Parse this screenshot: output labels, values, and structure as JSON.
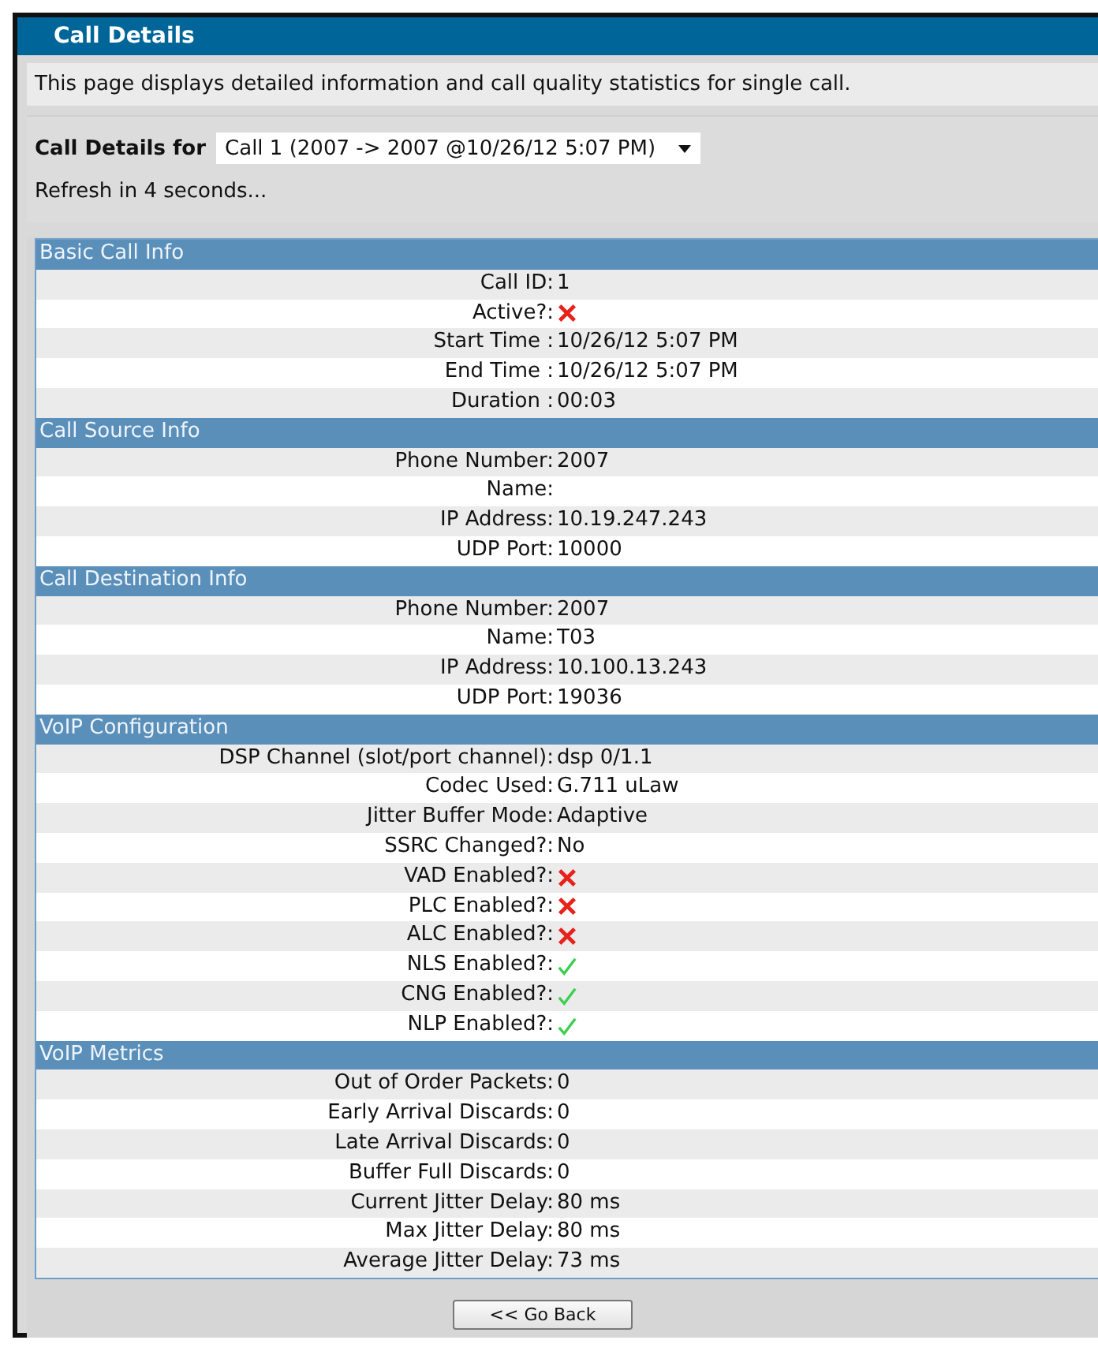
{
  "window": {
    "title": "Call Details"
  },
  "description": "This page displays detailed information and call quality statistics for single call.",
  "selector": {
    "label": "Call Details for",
    "value": "Call 1 (2007 -> 2007 @10/26/12 5:07 PM)"
  },
  "refresh": "Refresh in 4 seconds...",
  "sections": [
    {
      "title": "Basic Call Info",
      "rows": [
        {
          "label": "Call ID:",
          "kind": "text",
          "value": "1"
        },
        {
          "label": "Active?:",
          "kind": "flag",
          "on": false
        },
        {
          "label": "Start Time :",
          "kind": "text",
          "value": "10/26/12 5:07 PM"
        },
        {
          "label": "End Time :",
          "kind": "text",
          "value": "10/26/12 5:07 PM"
        },
        {
          "label": "Duration :",
          "kind": "text",
          "value": "00:03"
        }
      ]
    },
    {
      "title": "Call Source Info",
      "rows": [
        {
          "label": "Phone Number:",
          "kind": "text",
          "value": "2007"
        },
        {
          "label": "Name:",
          "kind": "text"
        },
        {
          "label": "IP Address:",
          "kind": "text",
          "value": "10.19.247.243"
        },
        {
          "label": "UDP Port:",
          "kind": "text",
          "value": "10000"
        }
      ]
    },
    {
      "title": "Call Destination Info",
      "rows": [
        {
          "label": "Phone Number:",
          "kind": "text",
          "value": "2007"
        },
        {
          "label": "Name:",
          "kind": "text",
          "value": "T03"
        },
        {
          "label": "IP Address:",
          "kind": "text",
          "value": "10.100.13.243"
        },
        {
          "label": "UDP Port:",
          "kind": "text",
          "value": "19036"
        }
      ]
    },
    {
      "title": "VoIP Configuration",
      "rows": [
        {
          "label": "DSP Channel (slot/port channel):",
          "kind": "text",
          "value": "dsp 0/1.1"
        },
        {
          "label": "Codec Used:",
          "kind": "text",
          "value": "G.711 uLaw"
        },
        {
          "label": "Jitter Buffer Mode:",
          "kind": "text",
          "value": "Adaptive"
        },
        {
          "label": "SSRC Changed?:",
          "kind": "text",
          "value": "No"
        },
        {
          "label": "VAD Enabled?:",
          "kind": "flag",
          "on": false
        },
        {
          "label": "PLC Enabled?:",
          "kind": "flag",
          "on": false
        },
        {
          "label": "ALC Enabled?:",
          "kind": "flag",
          "on": false
        },
        {
          "label": "NLS Enabled?:",
          "kind": "flag",
          "on": true
        },
        {
          "label": "CNG Enabled?:",
          "kind": "flag",
          "on": true
        },
        {
          "label": "NLP Enabled?:",
          "kind": "flag",
          "on": true
        }
      ]
    },
    {
      "title": "VoIP Metrics",
      "rows": [
        {
          "label": "Out of Order Packets:",
          "kind": "text",
          "value": "0"
        },
        {
          "label": "Early Arrival Discards:",
          "kind": "text",
          "value": "0"
        },
        {
          "label": "Late Arrival Discards:",
          "kind": "text",
          "value": "0"
        },
        {
          "label": "Buffer Full Discards:",
          "kind": "text",
          "value": "0"
        },
        {
          "label": "Current Jitter Delay:",
          "kind": "text",
          "value": "80 ms"
        },
        {
          "label": "Max Jitter Delay:",
          "kind": "text",
          "value": "80 ms"
        },
        {
          "label": "Average Jitter Delay:",
          "kind": "text",
          "value": "73 ms"
        }
      ]
    }
  ],
  "buttons": [
    "<< Go Back"
  ]
}
